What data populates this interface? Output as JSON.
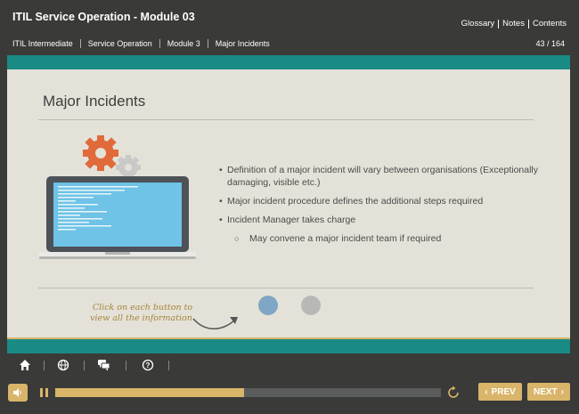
{
  "header": {
    "title": "ITIL Service Operation - Module 03",
    "links": [
      "Glossary",
      "Notes",
      "Contents"
    ],
    "breadcrumb": [
      "ITIL Intermediate",
      "Service Operation",
      "Module 3",
      "Major Incidents"
    ],
    "page_count": "43 / 164"
  },
  "slide": {
    "title": "Major Incidents",
    "bullets": [
      "Definition of a major incident will vary between organisations (Exceptionally damaging, visible etc.)",
      "Major incident procedure defines the additional steps required",
      "Incident Manager takes charge"
    ],
    "sub_bullet": "May convene a major incident team if required",
    "hint_line1": "Click on each button to",
    "hint_line2": "view all the information."
  },
  "player": {
    "progress": 0.49,
    "prev_label": "PREV",
    "next_label": "NEXT"
  },
  "colors": {
    "teal": "#1a8b84",
    "gold": "#d9b56a",
    "background": "#3a3a38",
    "slide": "#e4e2d8"
  },
  "icons": [
    "home-icon",
    "globe-icon",
    "chat-icon",
    "help-icon",
    "volume-icon",
    "pause-icon",
    "replay-icon"
  ]
}
